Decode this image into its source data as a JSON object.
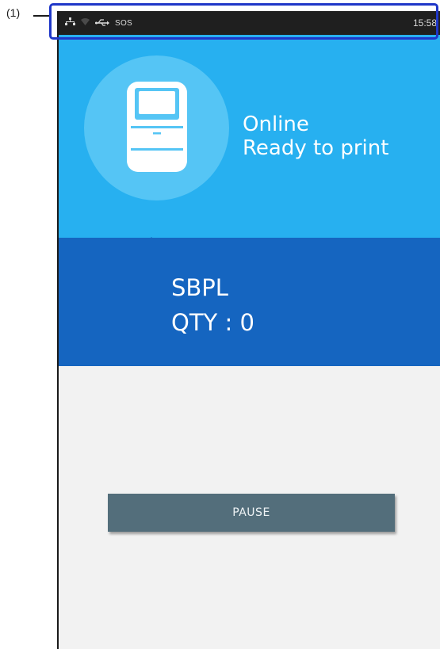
{
  "annotation": {
    "label": "(1)"
  },
  "statusbar": {
    "icons": [
      "network-icon",
      "wifi-icon",
      "usb-icon"
    ],
    "sos": "SOS",
    "time": "15:58"
  },
  "printer": {
    "status_line1": "Online",
    "status_line2": "Ready to print"
  },
  "job": {
    "language": "SBPL",
    "quantity": "QTY : 0"
  },
  "actions": {
    "pause_label": "PAUSE"
  },
  "colors": {
    "header": "#27b0f0",
    "info_band": "#1565c0",
    "pause_button": "#536e7b",
    "highlight": "#1f37c8"
  }
}
